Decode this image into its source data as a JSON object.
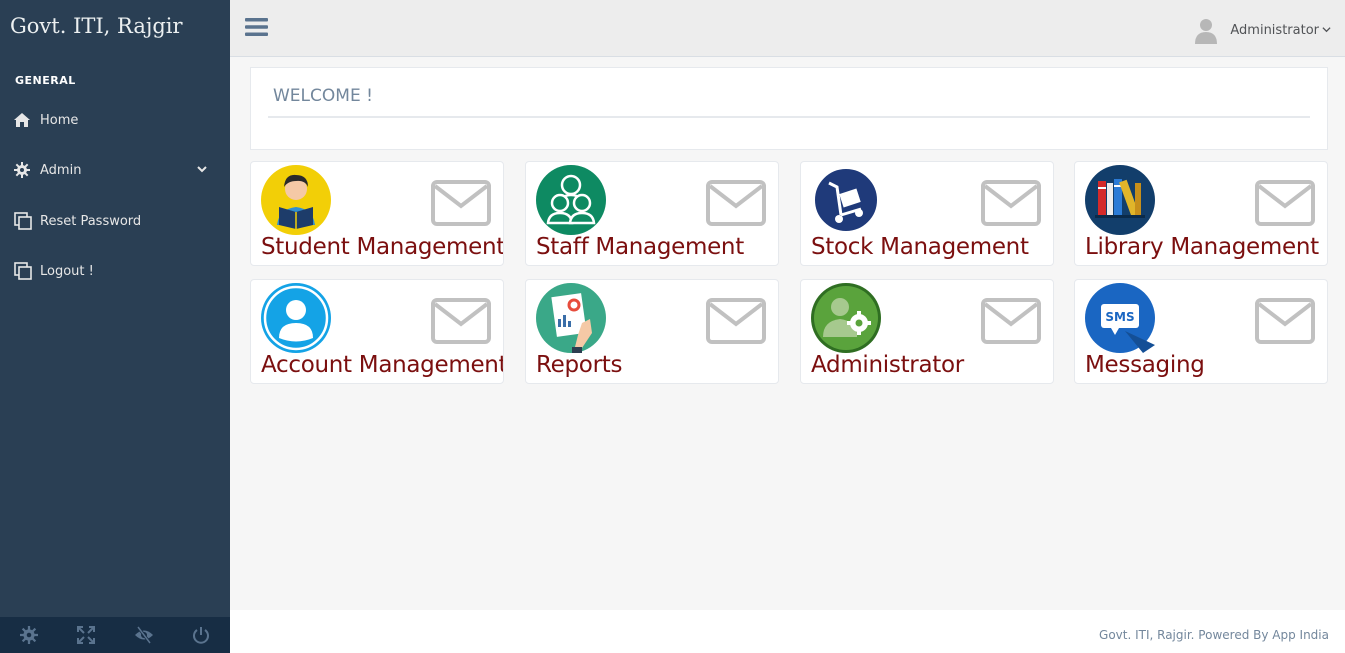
{
  "sidebar": {
    "brand": "Govt. ITI, Rajgir",
    "section_title": "GENERAL",
    "items": [
      {
        "label": "Home",
        "icon": "home-icon"
      },
      {
        "label": "Admin",
        "icon": "gear-icon"
      },
      {
        "label": "Reset Password",
        "icon": "clone-icon"
      },
      {
        "label": "Logout !",
        "icon": "clone-icon"
      }
    ],
    "footer_icons": [
      "settings-icon",
      "fullscreen-icon",
      "eye-slash-icon",
      "power-icon"
    ]
  },
  "topnav": {
    "user_name": "Administrator"
  },
  "welcome": {
    "title": "WELCOME !"
  },
  "tiles": [
    {
      "label": "Student Management",
      "icon": "student-icon"
    },
    {
      "label": "Staff Management",
      "icon": "staff-icon"
    },
    {
      "label": "Stock Management",
      "icon": "stock-icon"
    },
    {
      "label": "Library Management",
      "icon": "library-icon"
    },
    {
      "label": "Account Management",
      "icon": "account-icon"
    },
    {
      "label": "Reports",
      "icon": "reports-icon"
    },
    {
      "label": "Administrator",
      "icon": "administrator-icon"
    },
    {
      "label": "Messaging",
      "icon": "messaging-icon",
      "badge_text": "SMS"
    }
  ],
  "footer": {
    "text": "Govt. ITI, Rajgir. Powered By App India"
  },
  "colors": {
    "sidebar_bg": "#2a3f54",
    "tile_label": "#7b0f0f",
    "body_bg": "#f6f6f6"
  }
}
